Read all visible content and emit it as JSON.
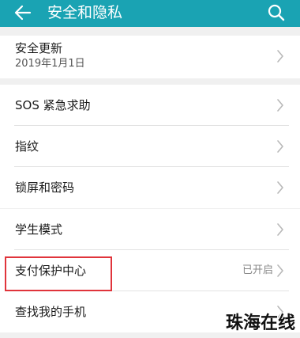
{
  "header": {
    "title": "安全和隐私",
    "background": "#1aa3b3",
    "back_icon": "arrow-left-icon",
    "search_icon": "search-icon"
  },
  "groups": [
    {
      "rows": [
        {
          "label": "安全更新",
          "sub": "2019年1月1日"
        }
      ]
    },
    {
      "rows": [
        {
          "label": "SOS 紧急求助"
        },
        {
          "label": "指纹"
        },
        {
          "label": "锁屏和密码"
        }
      ]
    },
    {
      "rows": [
        {
          "label": "学生模式"
        },
        {
          "label": "支付保护中心",
          "status": "已开启",
          "highlighted": true
        },
        {
          "label": "查找我的手机"
        }
      ]
    }
  ],
  "watermark": "珠海在线",
  "highlight_color": "#e0343b"
}
